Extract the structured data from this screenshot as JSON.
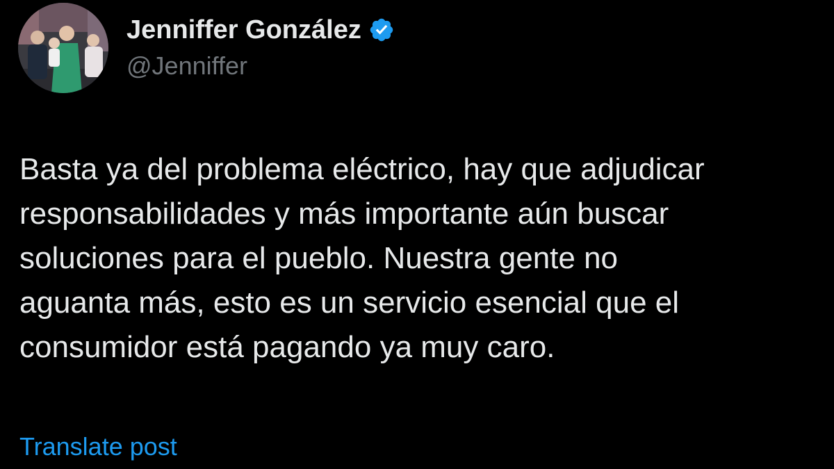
{
  "author": {
    "display_name": "Jenniffer González",
    "handle": "@Jenniffer",
    "verified_icon": "verified-badge-icon",
    "avatar_icon": "profile-photo"
  },
  "post": {
    "lines": [
      "Basta ya del problema eléctrico, hay que adjudicar",
      "responsabilidades y más importante aún buscar",
      "soluciones para el pueblo. Nuestra gente no",
      "aguanta más, esto es un servicio esencial que el",
      "consumidor está pagando ya muy caro."
    ]
  },
  "actions": {
    "translate_label": "Translate post"
  },
  "colors": {
    "background": "#000000",
    "text_primary": "#e7e9ea",
    "text_secondary": "#71767b",
    "accent": "#1d9bf0"
  }
}
